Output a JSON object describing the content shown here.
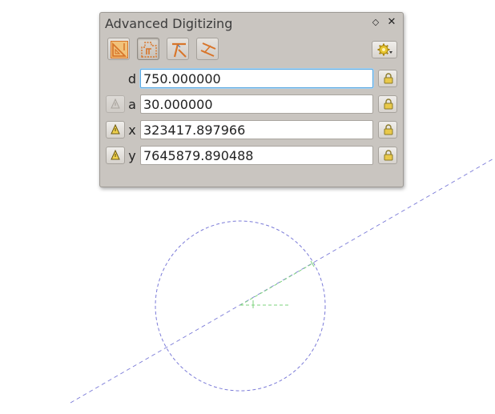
{
  "dock": {
    "title": "Advanced Digitizing",
    "float_icon": "diamond-float-icon",
    "close_icon": "close-icon"
  },
  "toolbar": {
    "buttons": [
      {
        "icon": "enable-cad-icon",
        "active": false
      },
      {
        "icon": "construction-mode-icon",
        "active": true
      },
      {
        "icon": "perpendicular-icon",
        "active": false
      },
      {
        "icon": "parallel-icon",
        "active": false
      }
    ],
    "settings_icon": "settings-gear-icon"
  },
  "fields": {
    "d": {
      "label": "d",
      "value": "750.000000"
    },
    "a": {
      "label": "a",
      "value": "30.000000"
    },
    "x": {
      "label": "x",
      "value": "323417.897966"
    },
    "y": {
      "label": "y",
      "value": "7645879.890488"
    }
  },
  "colors": {
    "guide_line": "#7b7bd8",
    "snap_line": "#7ed37e",
    "focus_border": "#5aa8e0",
    "icon_orange": "#d8752a"
  }
}
